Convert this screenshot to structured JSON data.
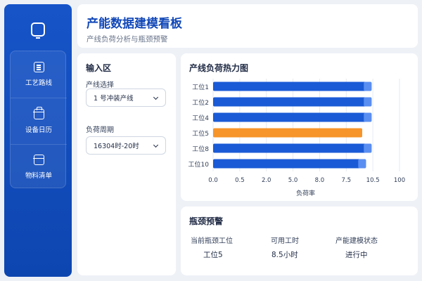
{
  "header": {
    "title": "产能数据建模看板",
    "subtitle": "产线负荷分析与瓶颈预警"
  },
  "sidebar": {
    "logo_icon": "monitor-icon",
    "items": [
      {
        "label": "工艺路线",
        "icon": "route-list-icon"
      },
      {
        "label": "设备日历",
        "icon": "calendar-icon"
      },
      {
        "label": "物料清单",
        "icon": "box-icon"
      }
    ]
  },
  "input_panel": {
    "title": "输入区",
    "line_label": "产线选择",
    "line_value": "1 号冲装产线",
    "period_label": "负荷周期",
    "period_value": "16304时-20时"
  },
  "heatmap": {
    "title": "产线负荷热力图"
  },
  "chart_data": {
    "type": "bar",
    "orientation": "horizontal",
    "categories": [
      "工位1",
      "工位2",
      "工位4",
      "工位5",
      "工位8",
      "工位10"
    ],
    "values": [
      8.5,
      8.5,
      8.5,
      8.0,
      8.5,
      8.2
    ],
    "highlight": "工位5",
    "xlabel": "负荷率",
    "xticks": [
      "0.0",
      "0.5",
      "2.0",
      "5.0",
      "8.0",
      "7.5",
      "10.5",
      "100"
    ],
    "colors": {
      "normal": "#1a5ad6",
      "normal_tail": "#5a8ef0",
      "bottleneck": "#f7942a"
    },
    "grid": true
  },
  "alert": {
    "title": "瓶颈预警",
    "columns": [
      {
        "head": "当前瓶颈工位",
        "value": "工位5"
      },
      {
        "head": "可用工时",
        "value": "8.5小时"
      },
      {
        "head": "产能建模状态",
        "value": "进行中"
      }
    ]
  }
}
